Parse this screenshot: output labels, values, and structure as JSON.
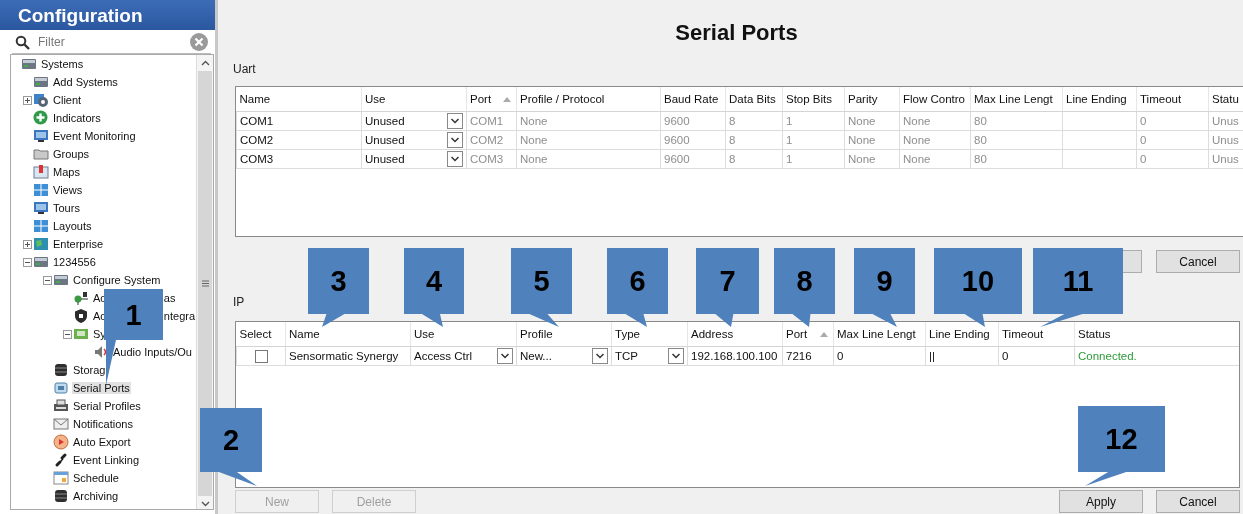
{
  "sidebar": {
    "title": "Configuration",
    "filter_placeholder": "Filter",
    "tree": [
      {
        "label": "Systems",
        "selected": false,
        "children": [
          {
            "label": "Add Systems",
            "selected": false
          },
          {
            "label": "Client",
            "selected": false,
            "expanded": false
          },
          {
            "label": "Indicators",
            "selected": false
          },
          {
            "label": "Event Monitoring",
            "selected": false
          },
          {
            "label": "Groups",
            "selected": false
          },
          {
            "label": "Maps",
            "selected": false
          },
          {
            "label": "Views",
            "selected": false
          },
          {
            "label": "Tours",
            "selected": false
          },
          {
            "label": "Layouts",
            "selected": false
          },
          {
            "label": "Enterprise",
            "selected": false,
            "expanded": false
          },
          {
            "label": "1234556",
            "selected": false,
            "expanded": true,
            "children": [
              {
                "label": "Configure System",
                "selected": false,
                "expanded": true,
                "children": [
                  {
                    "label": "Ac",
                    "tail": "as",
                    "selected": false
                  },
                  {
                    "label": "Ac",
                    "tail": "ntegra",
                    "selected": false
                  },
                  {
                    "label": "Sy",
                    "selected": false,
                    "expanded": true,
                    "children": [
                      {
                        "label": "Audio Inputs/Ou",
                        "selected": false
                      }
                    ]
                  }
                ]
              },
              {
                "label": "Storag",
                "selected": false
              },
              {
                "label": "Serial Ports",
                "selected": true
              },
              {
                "label": "Serial Profiles",
                "selected": false
              },
              {
                "label": "Notifications",
                "selected": false
              },
              {
                "label": "Auto Export",
                "selected": false
              },
              {
                "label": "Event Linking",
                "selected": false
              },
              {
                "label": "Schedule",
                "selected": false
              },
              {
                "label": "Archiving",
                "selected": false
              }
            ]
          }
        ]
      }
    ]
  },
  "page": {
    "title": "Serial Ports"
  },
  "uart": {
    "label": "Uart",
    "columns": [
      {
        "label": "Name",
        "kind": "text",
        "sorted": false
      },
      {
        "label": "Use",
        "kind": "dropdown",
        "sorted": false
      },
      {
        "label": "Port",
        "kind": "readonly",
        "sorted": true
      },
      {
        "label": "Profile / Protocol",
        "kind": "readonly",
        "sorted": false
      },
      {
        "label": "Baud Rate",
        "kind": "readonly",
        "sorted": false
      },
      {
        "label": "Data Bits",
        "kind": "readonly",
        "sorted": false
      },
      {
        "label": "Stop Bits",
        "kind": "readonly",
        "sorted": false
      },
      {
        "label": "Parity",
        "kind": "readonly",
        "sorted": false
      },
      {
        "label": "Flow Contro",
        "kind": "readonly",
        "sorted": false
      },
      {
        "label": "Max Line Lengt",
        "kind": "readonly",
        "sorted": false
      },
      {
        "label": "Line Ending",
        "kind": "readonly",
        "sorted": false
      },
      {
        "label": "Timeout",
        "kind": "readonly",
        "sorted": false
      },
      {
        "label": "Statu",
        "kind": "readonly"
      }
    ],
    "rows": [
      {
        "cells": [
          "COM1",
          "Unused",
          "COM1",
          "None",
          "9600",
          "8",
          "1",
          "None",
          "None",
          "80",
          null,
          "0",
          "Unus"
        ]
      },
      {
        "cells": [
          "COM2",
          "Unused",
          "COM2",
          "None",
          "9600",
          "8",
          "1",
          "None",
          "None",
          "80",
          null,
          "0",
          "Unus"
        ]
      },
      {
        "cells": [
          "COM3",
          "Unused",
          "COM3",
          "None",
          "9600",
          "8",
          "1",
          "None",
          "None",
          "80",
          null,
          "0",
          "Unus"
        ]
      }
    ],
    "buttons": [
      {
        "label": "Cancel",
        "disabled": false
      }
    ]
  },
  "ip": {
    "label": "IP",
    "columns": [
      {
        "label": "Select",
        "kind": "check",
        "sorted": false
      },
      {
        "label": "Name",
        "kind": "text",
        "sorted": false
      },
      {
        "label": "Use",
        "kind": "dropdown",
        "sorted": false
      },
      {
        "label": "Profile",
        "kind": "dropdown",
        "sorted": false
      },
      {
        "label": "Type",
        "kind": "dropdown",
        "sorted": false
      },
      {
        "label": "Address",
        "kind": "text",
        "sorted": false
      },
      {
        "label": "Port",
        "kind": "text",
        "sorted": true
      },
      {
        "label": "Max Line Lengt",
        "kind": "text",
        "sorted": false
      },
      {
        "label": "Line Ending",
        "kind": "text",
        "sorted": false
      },
      {
        "label": "Timeout",
        "kind": "text",
        "sorted": false
      },
      {
        "label": "Status",
        "kind": "status",
        "sorted": false
      }
    ],
    "rows": [
      {
        "cells": [
          {
            "checked": false
          },
          "Sensormatic Synergy",
          "Access Ctrl",
          "New...",
          "TCP",
          "192.168.100.100",
          "7216",
          "0",
          "||",
          "0",
          "Connected."
        ]
      }
    ]
  },
  "footer": {
    "left_buttons": [
      {
        "label": "New",
        "disabled": true
      },
      {
        "label": "Delete",
        "disabled": true
      }
    ],
    "right_buttons": [
      {
        "label": "Apply",
        "disabled": false
      },
      {
        "label": "Cancel",
        "disabled": false
      }
    ]
  },
  "callouts": [
    {
      "number": "1"
    },
    {
      "number": "2"
    },
    {
      "number": "3"
    },
    {
      "number": "4"
    },
    {
      "number": "5"
    },
    {
      "number": "6"
    },
    {
      "number": "7"
    },
    {
      "number": "8"
    },
    {
      "number": "9"
    },
    {
      "number": "10"
    },
    {
      "number": "11"
    },
    {
      "number": "12"
    }
  ]
}
